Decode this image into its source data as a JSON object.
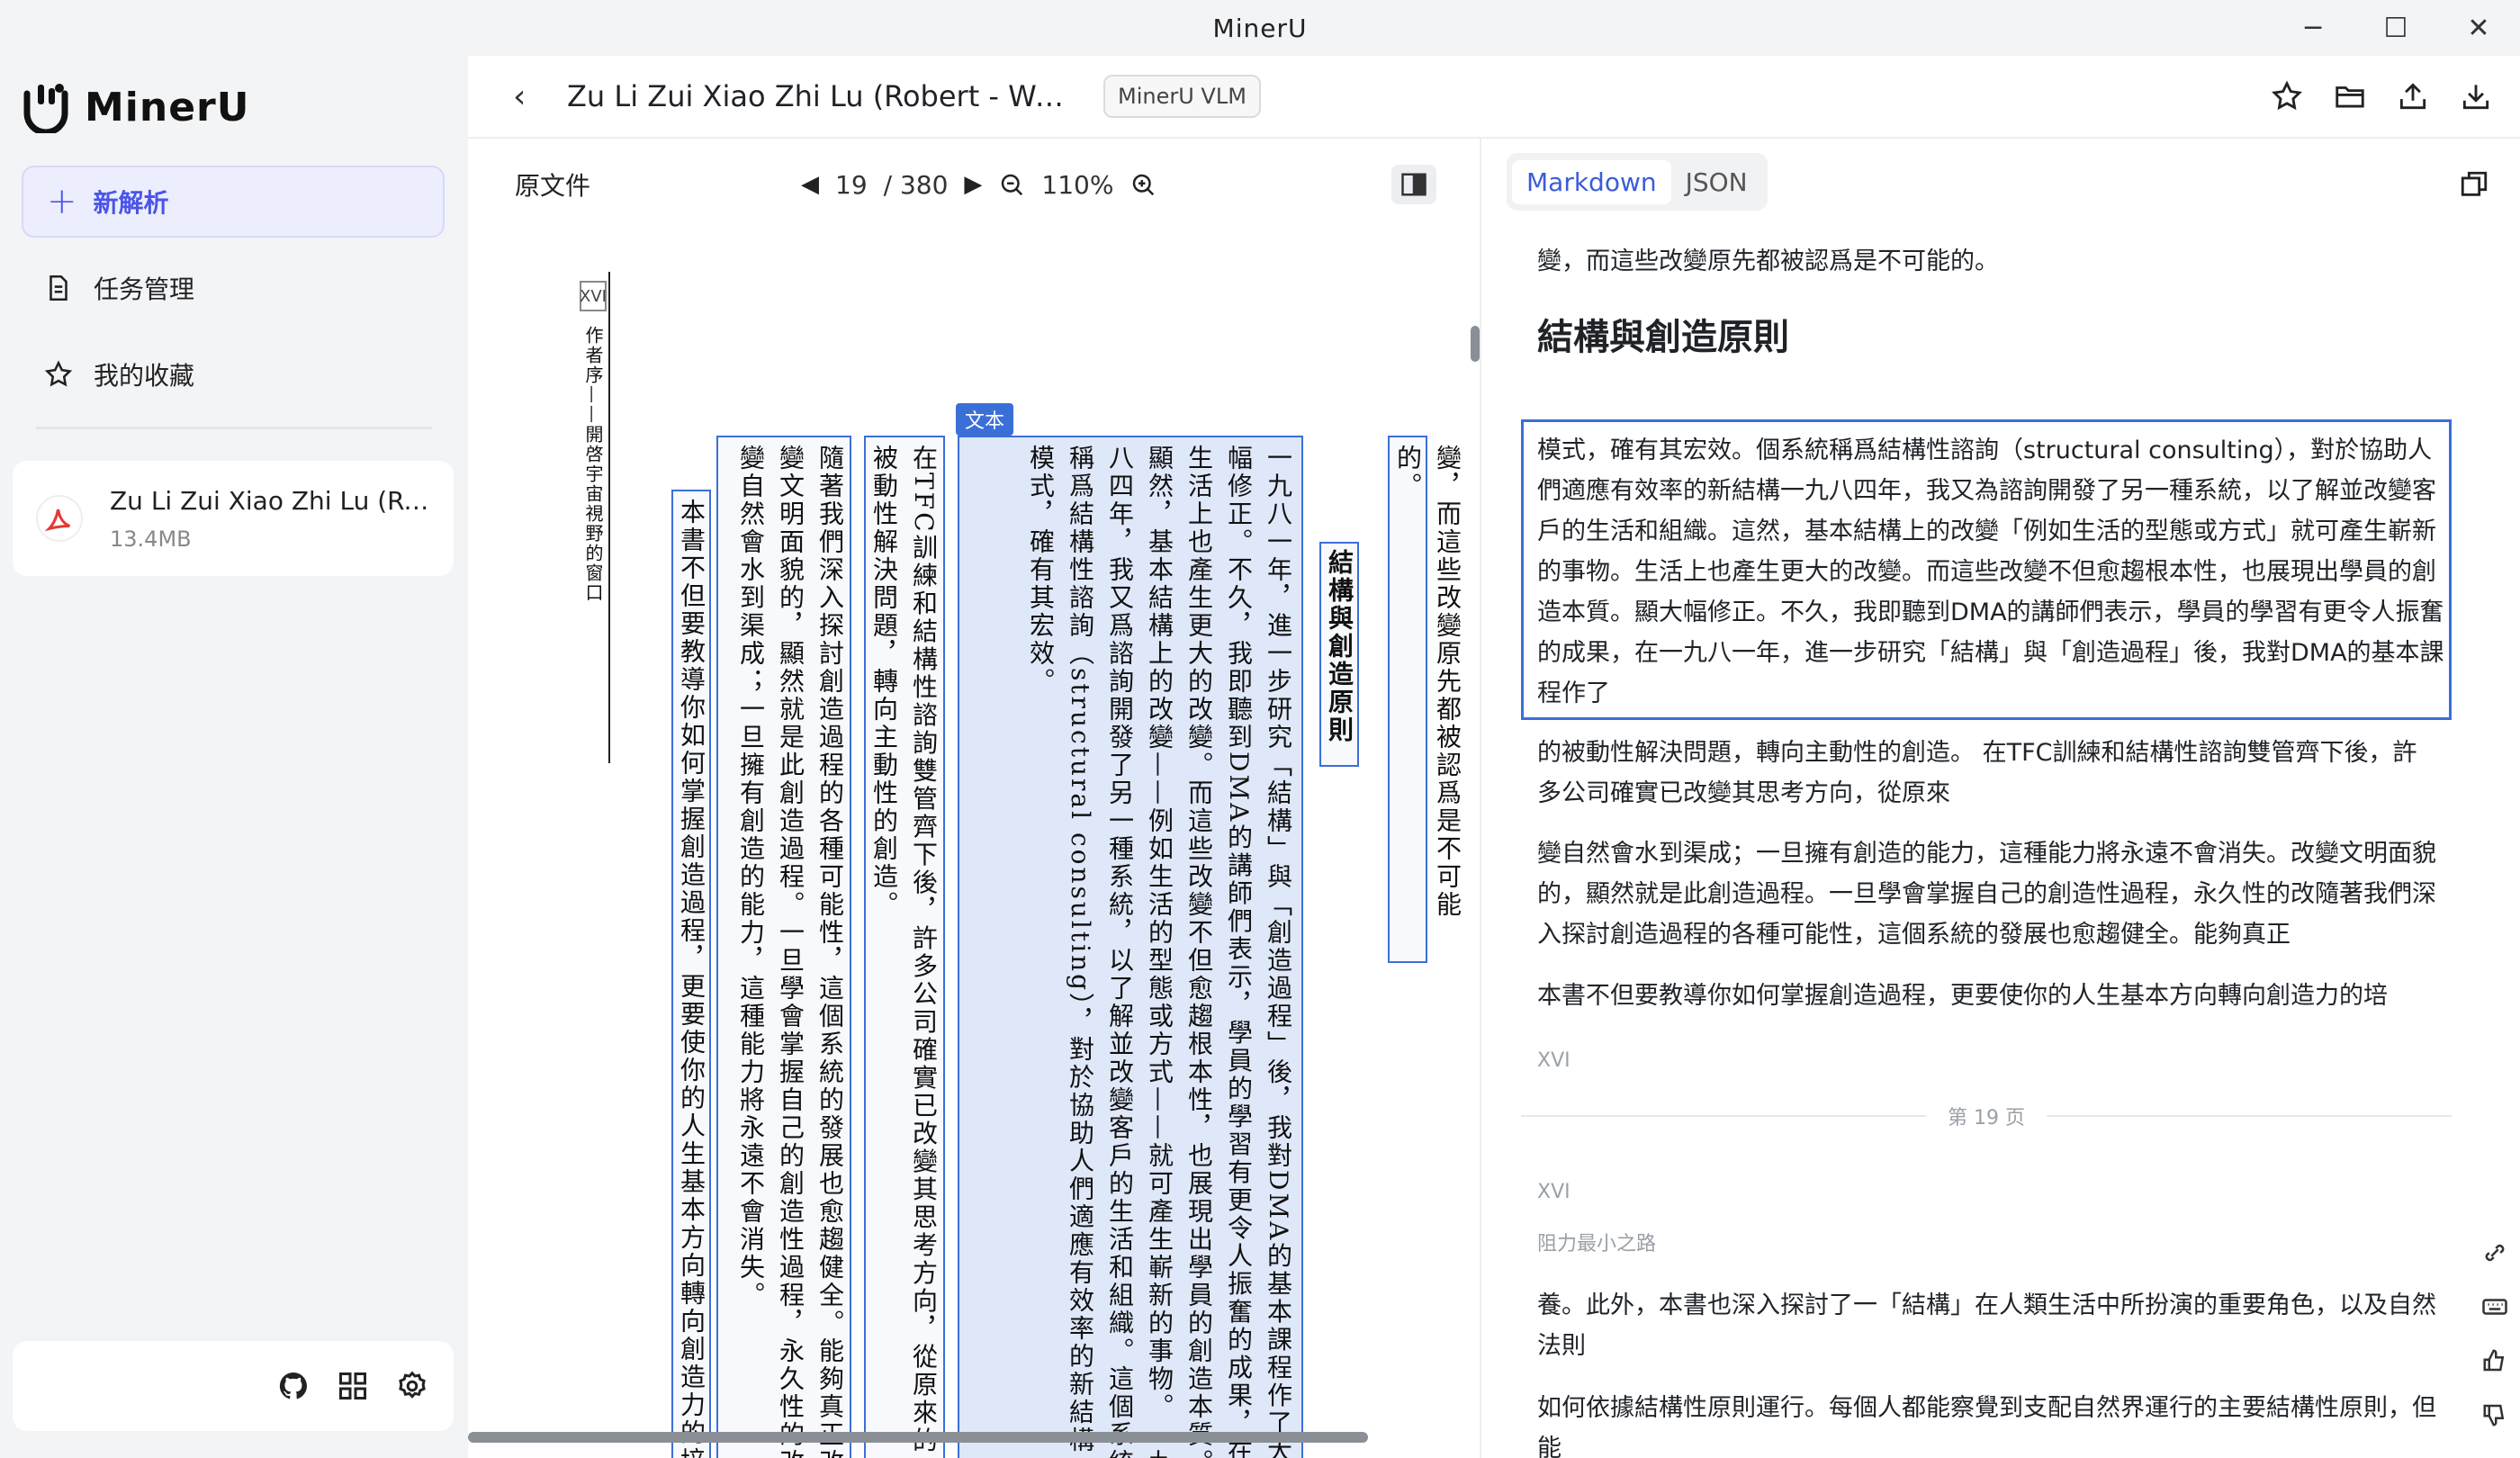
{
  "window": {
    "title": "MinerU",
    "controls": [
      "─",
      "☐",
      "✕"
    ]
  },
  "sidebar": {
    "logo_text": "MinerU",
    "new_button": "新解析",
    "nav": [
      {
        "label": "任务管理",
        "icon": "document-icon"
      },
      {
        "label": "我的收藏",
        "icon": "star-icon"
      }
    ],
    "file": {
      "name": "Zu Li Zui Xiao Zhi Lu (Robert - Wei Zhi Fu Ci)",
      "size": "13.4MB"
    },
    "footer_icons": [
      "github-icon",
      "grid-icon",
      "gear-icon"
    ]
  },
  "header": {
    "doc_title": "Zu Li Zui Xiao Zhi Lu (Robert - Wei Zhi Fu Ci)",
    "model_badge": "MinerU VLM",
    "actions": [
      "star-icon",
      "folder-icon",
      "share-icon",
      "download-icon"
    ]
  },
  "viewer": {
    "label": "原文件",
    "page_current": "19",
    "page_total": "/ 380",
    "zoom": "110%",
    "page_marker": "XVI",
    "running_header": "作者序——開啓宇宙視野的窗口",
    "tag": "文本",
    "columns": [
      "變，而這些改變原先都被認爲是不可能的。",
      "結構與創造原則",
      "一九八一年，進一步研究「結構」與「創造過程」後，我對DMA的基本課程作了大幅修正。不久，我即聽到DMA的講師們表示，學員的學習有更令人振奮的成果，在生活上也產生更大的改變。而這些改變不但愈趨根本性，也展現出學員的創造本質。顯然，基本結構上的改變——例如生活的型態或方式——就可產生嶄新的事物。一九八四年，我又爲諮詢開發了另一種系統，以了解並改變客戶的生活和組織。這個系統稱爲結構性諮詢（structural consulting），對於協助人們適應有效率的新結構模式，確有其宏效。",
      "在TFC訓練和結構性諮詢雙管齊下後，許多公司確實已改變其思考方向，從原來的被動性解決問題，轉向主動性的創造。",
      "隨著我們深入探討創造過程的各種可能性，這個系統的發展也愈趨健全。能夠真正改變文明面貌的，顯然就是此創造過程。一旦學會掌握自己的創造性過程，永久性的改變自然會水到渠成；一旦擁有創造的能力，這種能力將永遠不會消失。",
      "本書不但要教導你如何掌握創造過程，更要使你的人生基本方向轉向創造力的培"
    ]
  },
  "markdown": {
    "tabs": [
      "Markdown",
      "JSON"
    ],
    "active_tab": "Markdown",
    "blocks": {
      "p0": "變，而這些改變原先都被認爲是不可能的。",
      "h": "結構與創造原則",
      "p1": "模式，確有其宏效。個系統稱爲結構性諮詢（structural consulting），對於協助人們適應有效率的新結構一九八四年，我又為諮詢開發了另一種系統，以了解並改變客戶的生活和組織。這然，基本結構上的改變「例如生活的型態或方式」就可產生嶄新的事物。生活上也產生更大的改變。而這些改變不但愈趨根本性，也展現出學員的創造本質。顯大幅修正。不久，我即聽到DMA的講師們表示，學員的學習有更令人振奮的成果，在一九八一年，進一步研究「結構」與「創造過程」後，我對DMA的基本課程作了",
      "p2": "的被動性解決問題，轉向主動性的創造。 在TFC訓練和結構性諮詢雙管齊下後，許多公司確實已改變其思考方向，從原來",
      "p3": "變自然會水到渠成；一旦擁有創造的能力，這種能力將永遠不會消失。改變文明面貌的，顯然就是此創造過程。一旦學會掌握自己的創造性過程，永久性的改隨著我們深入探討創造過程的各種可能性，這個系統的發展也愈趨健全。能夠真正",
      "p4": "本書不但要教導你如何掌握創造過程，更要使你的人生基本方向轉向創造力的培",
      "m1": "XVI",
      "page_divider": "第 19 页",
      "m2": "XVI",
      "m3": "阻力最小之路",
      "p5": "養。此外，本書也深入探討了一「結構」在人類生活中所扮演的重要角色，以及自然法則",
      "p6": "如何依據結構性原則運行。每個人都能察覺到支配自然界運行的主要結構性原則，但能"
    }
  },
  "colors": {
    "accent": "#3b6fd8",
    "brand": "#4b55e6",
    "pdf_red": "#e53935"
  }
}
